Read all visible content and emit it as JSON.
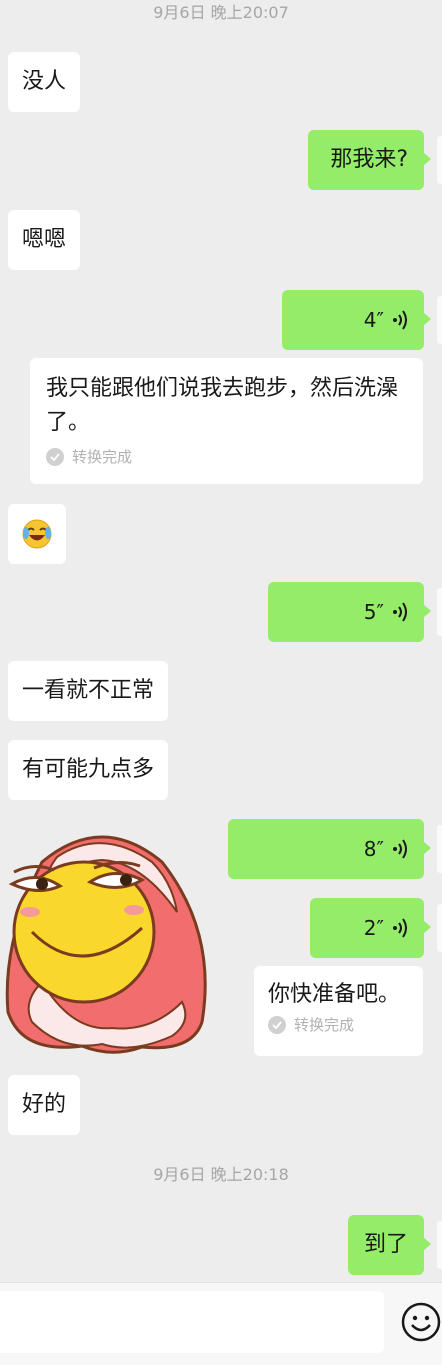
{
  "timestamps": [
    "9月6日 晚上20:07",
    "9月6日 晚上20:18"
  ],
  "messages": [
    {
      "side": "in",
      "text": "没人"
    },
    {
      "side": "out",
      "text": "那我来?"
    },
    {
      "side": "in",
      "text": "嗯嗯"
    },
    {
      "side": "out",
      "type": "voice",
      "duration": "4″"
    },
    {
      "side": "out",
      "type": "transcript",
      "text": "我只能跟他们说我去跑步，然后洗澡了。",
      "status": "转换完成"
    },
    {
      "side": "in",
      "type": "emoji",
      "icon": "laughing-crying-emoji"
    },
    {
      "side": "out",
      "type": "voice",
      "duration": "5″"
    },
    {
      "side": "in",
      "text": "一看就不正常"
    },
    {
      "side": "in",
      "text": "有可能九点多"
    },
    {
      "side": "in",
      "type": "sticker",
      "icon": "smirking-face-blanket-sticker"
    },
    {
      "side": "out",
      "type": "voice",
      "duration": "8″"
    },
    {
      "side": "out",
      "type": "voice",
      "duration": "2″"
    },
    {
      "side": "out",
      "type": "transcript",
      "text": "你快准备吧。",
      "status": "转换完成"
    },
    {
      "side": "in",
      "text": "好的"
    },
    {
      "side": "out",
      "text": "到了"
    }
  ],
  "input": {
    "placeholder": ""
  },
  "colors": {
    "background": "#ededed",
    "outgoing": "#95ec69",
    "incoming": "#ffffff",
    "timestamp": "#a6a6a6"
  }
}
